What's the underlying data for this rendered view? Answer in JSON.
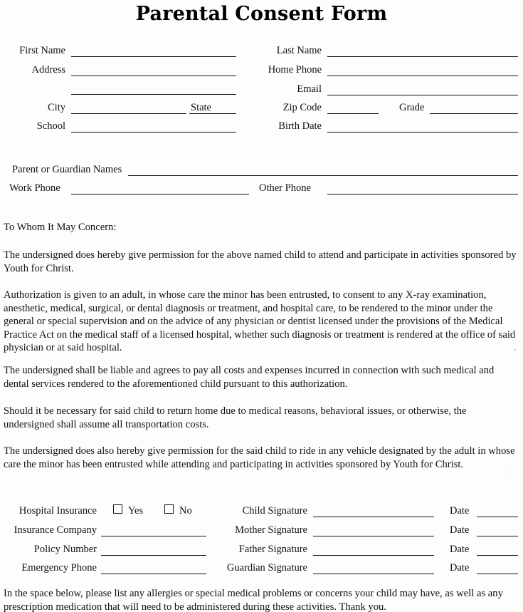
{
  "document": {
    "title": "Parental Consent Form"
  },
  "child_info": {
    "left_fields": [
      {
        "label": "First Name",
        "value": "",
        "placeholder": ""
      },
      {
        "label": "Address",
        "value": "",
        "placeholder": ""
      },
      {
        "label": "",
        "value": "",
        "placeholder": ""
      },
      {
        "label": "City",
        "value": "",
        "placeholder": ""
      },
      {
        "label": "School",
        "value": "",
        "placeholder": ""
      }
    ],
    "state_label": "State",
    "right_fields": [
      {
        "label": "Last Name",
        "value": "",
        "placeholder": ""
      },
      {
        "label": "Home Phone",
        "value": "",
        "placeholder": ""
      },
      {
        "label": "Email",
        "value": "",
        "placeholder": ""
      },
      {
        "label": "Zip Code",
        "value": "",
        "placeholder": ""
      },
      {
        "label": "Birth Date",
        "value": "",
        "placeholder": ""
      }
    ],
    "grade_label": "Grade"
  },
  "guardian_info": {
    "names_label": "Parent or Guardian Names",
    "names_value": "",
    "work_phone_label": "Work Phone",
    "work_phone_value": "",
    "other_phone_label": "Other Phone",
    "other_phone_value": ""
  },
  "body": {
    "salutation": "To Whom It May Concern:",
    "paragraphs": [
      "The undersigned does hereby give permission for the above named child to attend and participate in activities sponsored by Youth for Christ.",
      "Authorization is given to an adult, in whose care the minor has been entrusted, to consent to any X-ray examination, anesthetic, medical, surgical, or dental diagnosis or treatment, and hospital care, to be rendered to the minor under the general or special supervision and on the advice of any physician or dentist licensed under the provisions of the Medical Practice Act on the medical staff of a licensed hospital, whether such diagnosis or treatment is rendered at the office of said physician or at said hospital.",
      "The undersigned shall be liable and agrees to pay all costs and expenses incurred in connection with such medical and dental services rendered to the aforementioned child pursuant to this authorization.",
      "Should it be necessary for said child to return home due to medical reasons, behavioral issues, or otherwise, the undersigned shall assume all transportation costs.",
      "The undersigned does also hereby give permission for the said child to ride in any vehicle designated by the adult in whose care the minor has been entrusted while attending and participating in activities sponsored by Youth for Christ."
    ]
  },
  "insurance": {
    "hospital_insurance_label": "Hospital Insurance",
    "yes_label": "Yes",
    "no_label": "No",
    "yes_checked": false,
    "no_checked": false,
    "fields": [
      {
        "label": "Insurance Company",
        "value": ""
      },
      {
        "label": "Policy Number",
        "value": ""
      },
      {
        "label": "Emergency Phone",
        "value": ""
      }
    ]
  },
  "signatures": {
    "date_label": "Date",
    "rows": [
      {
        "label": "Child Signature",
        "value": "",
        "date": ""
      },
      {
        "label": "Mother Signature",
        "value": "",
        "date": ""
      },
      {
        "label": "Father Signature",
        "value": "",
        "date": ""
      },
      {
        "label": "Guardian Signature",
        "value": "",
        "date": ""
      }
    ]
  },
  "footer": {
    "note": "In the space below, please list any allergies or special medical problems or concerns your child may have, as well as any prescription medication that will need to be administered during these activities.  Thank you."
  }
}
